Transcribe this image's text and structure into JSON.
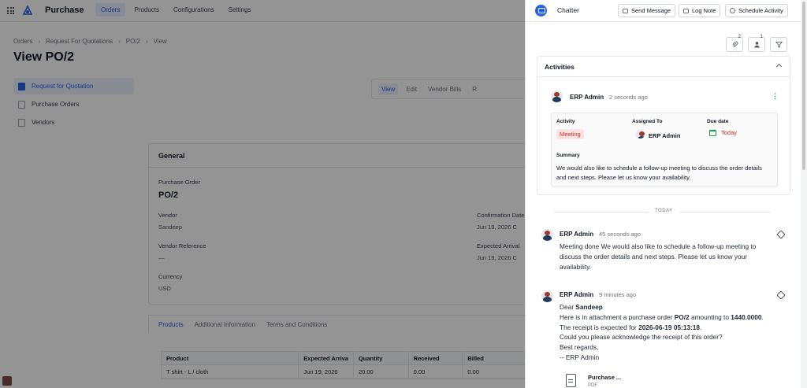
{
  "topbar": {
    "app_title": "Purchase",
    "nav": [
      "Orders",
      "Products",
      "Configurations",
      "Settings"
    ]
  },
  "breadcrumb": [
    "Orders",
    "Request For Quotations",
    "PO/2",
    "View"
  ],
  "page_title": "View PO/2",
  "sidenav": [
    "Request for Quotation",
    "Purchase Orders",
    "Vendors"
  ],
  "view_tabs": [
    "View",
    "Edit",
    "Vendor Bills",
    "R"
  ],
  "general": {
    "heading": "General",
    "purchase_order_label": "Purchase Order",
    "purchase_order_value": "PO/2",
    "vendor_label": "Vendor",
    "vendor_value": "Sandeep",
    "vendor_ref_label": "Vendor Reference",
    "vendor_ref_value": "—",
    "currency_label": "Currency",
    "currency_value": "USD",
    "confirmation_label": "Confirmation Date",
    "confirmation_value": "Jun 19, 2026 C",
    "expected_label": "Expected Arrival",
    "expected_value": "Jun 19, 2026 C"
  },
  "product_tabs": [
    "Products",
    "Additional Information",
    "Terms and Conditions"
  ],
  "table": {
    "headers": [
      "Product",
      "Expected Arriva",
      "Quantity",
      "Received",
      "Billed"
    ],
    "rows": [
      [
        "T shirt - L / cloth",
        "Jun 19, 2026",
        "20.00",
        "0.00",
        "0.00"
      ]
    ]
  },
  "chatter": {
    "title": "Chatter",
    "buttons": {
      "send_message": "Send Message",
      "log_note": "Log Note",
      "schedule_activity": "Schedule Activity"
    },
    "counts": {
      "attachments": "2",
      "followers": "1"
    },
    "activities": {
      "heading": "Activities",
      "user": "ERP Admin",
      "time": "2 seconds ago",
      "activity_label": "Activity",
      "activity_value": "Meeting",
      "assigned_label": "Assigned To",
      "assigned_value": "ERP Admin",
      "due_label": "Due date",
      "due_value": "Today",
      "summary_label": "Summary",
      "summary_text": "We would also like to schedule a follow-up meeting to discuss the order details and next steps. Please let us know your availability."
    },
    "separator": "TODAY",
    "messages": [
      {
        "user": "ERP Admin",
        "time": "45 seconds ago",
        "line1": "Meeting done We would also like to schedule a follow-up meeting to",
        "line2": "discuss the order details and next steps. Please let us know your",
        "line3": "availability."
      },
      {
        "user": "ERP Admin",
        "time": "9 minutes ago",
        "greeting_prefix": "Dear ",
        "greeting_name": "Sandeep",
        "line1_a": "Here is in attachment a purchase order ",
        "line1_po": "PO/2",
        "line1_b": " amounting to ",
        "line1_amount": "1440.0000",
        "line1_c": ".",
        "line2_a": "The receipt is expected for ",
        "line2_date": "2026-06-19 05:13:18",
        "line2_b": ".",
        "line3": "Could you please acknowledge the receipt of this order?",
        "line4": "Best regards,",
        "line5": "-- ERP Admin",
        "attachment_name": "Purchase ...",
        "attachment_type": "PDF"
      }
    ]
  },
  "colors": {
    "accent": "#2563eb",
    "danger": "#dc2626",
    "success": "#16a34a"
  }
}
